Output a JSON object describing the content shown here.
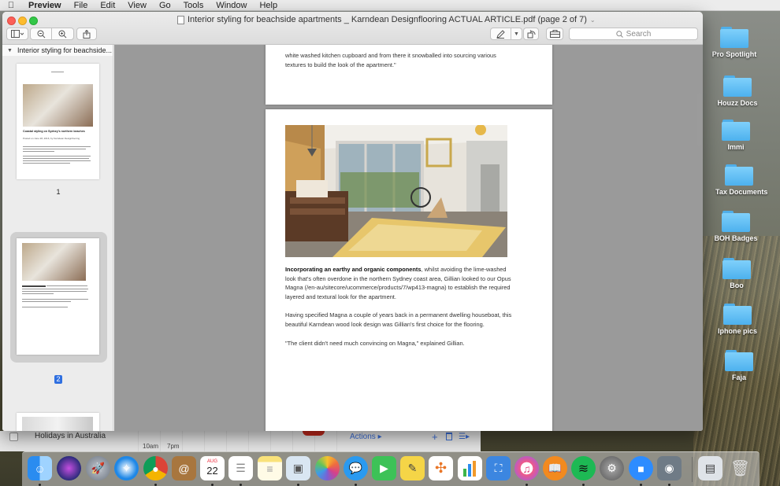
{
  "menubar": {
    "app_name": "Preview",
    "items": [
      "File",
      "Edit",
      "View",
      "Go",
      "Tools",
      "Window",
      "Help"
    ]
  },
  "window": {
    "title": "Interior styling for beachside apartments _ Karndean Designflooring ACTUAL ARTICLE.pdf (page 2 of 7)",
    "search_placeholder": "Search"
  },
  "sidebar": {
    "doc_label": "Interior styling for beachside...",
    "pages": [
      {
        "number": "1",
        "heading": "Coastal styling on Sydney's northern beaches",
        "byline": "Posted on June 28, 2016, by Karndean Designflooring"
      },
      {
        "number": "2"
      }
    ]
  },
  "document": {
    "top_text": "white washed kitchen cupboard and from there it snowballed into sourcing various textures to build the look of the apartment.\"",
    "para1_bold": "Incorporating an earthy and organic components",
    "para1_rest": ", whilst avoiding the lime-washed look that's often overdone in the northern Sydney coast area, Gillian looked to our Opus Magna (/en-au/sitecore/ucommerce/products/7/wp413-magna) to establish the required layered and textural look for the apartment.",
    "para2": "Having specified Magna a couple of years back in a permanent dwelling houseboat, this beautiful Karndean wood look design was Gillian's first choice for the flooring.",
    "para3": "\"The client didn't need much convincing on Magna,\" explained Gillian."
  },
  "background_app": {
    "task": "Holidays in Australia",
    "time_a": "10am",
    "time_b": "7pm",
    "actions_label": "Actions ▸"
  },
  "desktop_folders": [
    "Pro Spotlight",
    "Houzz Docs",
    "Immi",
    "Tax Documents",
    "BOH Badges",
    "Boo",
    "Iphone pics",
    "Faja"
  ],
  "dock": {
    "calendar_month": "AUG",
    "calendar_day": "22",
    "icons": [
      "finder-icon",
      "siri-icon",
      "launchpad-icon",
      "safari-icon",
      "chrome-icon",
      "contacts-icon",
      "calendar-icon",
      "reminders-icon",
      "notes-icon",
      "preview-icon",
      "photos-icon",
      "messages-icon",
      "facetime-icon",
      "stickies-icon",
      "tableau-icon",
      "numbers-icon",
      "keynote-icon",
      "itunes-icon",
      "ibooks-icon",
      "spotify-icon",
      "system-preferences-icon",
      "zoom-icon",
      "image-capture-icon",
      "downloads-stack-icon",
      "trash-icon"
    ]
  },
  "colors": {
    "accent": "#2f6fe0",
    "folder": "#4db1ee",
    "close": "#fc5f57",
    "minimize": "#fdbc2e",
    "maximize": "#33c748"
  }
}
